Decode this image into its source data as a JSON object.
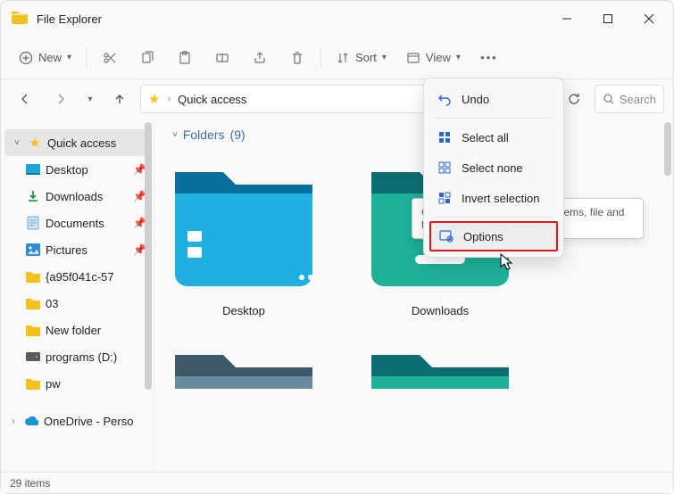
{
  "window": {
    "title": "File Explorer"
  },
  "toolbar": {
    "new_label": "New",
    "sort_label": "Sort",
    "view_label": "View"
  },
  "address": {
    "crumb": "Quick access"
  },
  "search": {
    "placeholder": "Search"
  },
  "sidebar": {
    "quick_access": {
      "label": "Quick access"
    },
    "items": [
      {
        "label": "Desktop",
        "pinned": true
      },
      {
        "label": "Downloads",
        "pinned": true
      },
      {
        "label": "Documents",
        "pinned": true
      },
      {
        "label": "Pictures",
        "pinned": true
      },
      {
        "label": "{a95f041c-57"
      },
      {
        "label": "03"
      },
      {
        "label": "New folder"
      },
      {
        "label": "programs (D:)"
      },
      {
        "label": "pw"
      }
    ],
    "onedrive": {
      "label": "OneDrive - Perso"
    }
  },
  "content": {
    "section_header": "Folders",
    "section_count": "(9)",
    "tiles": [
      {
        "caption": "Desktop"
      },
      {
        "caption": "Downloads"
      }
    ]
  },
  "menu": {
    "undo": "Undo",
    "select_all": "Select all",
    "select_none": "Select none",
    "invert": "Invert selection",
    "options": "Options"
  },
  "tooltip": {
    "text": "Change settings for opening items, file and folder views, and search."
  },
  "status": {
    "text": "29 items"
  }
}
